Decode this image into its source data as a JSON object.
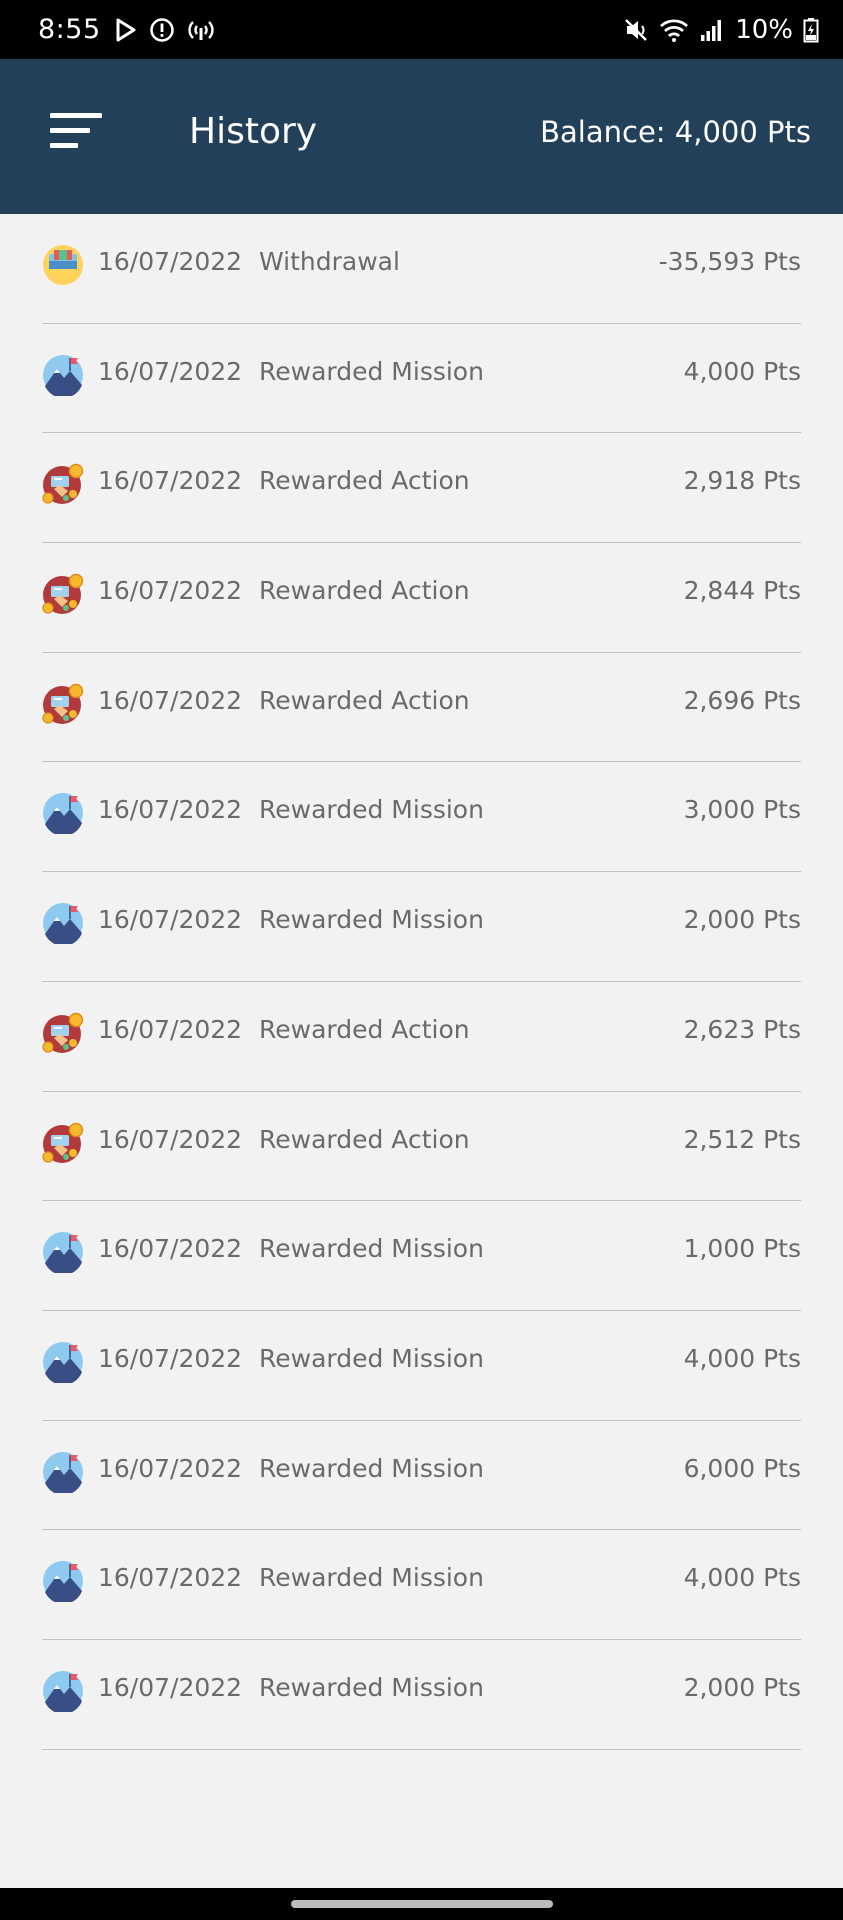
{
  "status_bar": {
    "time": "8:55",
    "battery": "10%",
    "left_icons": [
      "play-store-icon",
      "alert-icon",
      "hotspot-icon"
    ],
    "right_icons": [
      "mute-icon",
      "wifi-icon",
      "signal-icon",
      "battery-charging-icon"
    ]
  },
  "app_bar": {
    "title": "History",
    "balance": "Balance: 4,000 Pts",
    "menu_icon": "menu-icon",
    "background": "#22405a"
  },
  "history": {
    "rows": [
      {
        "icon": "withdrawal",
        "date": "16/07/2022",
        "type": "Withdrawal",
        "amount": "-35,593 Pts"
      },
      {
        "icon": "mission",
        "date": "16/07/2022",
        "type": "Rewarded Mission",
        "amount": "4,000 Pts"
      },
      {
        "icon": "action",
        "date": "16/07/2022",
        "type": "Rewarded Action",
        "amount": "2,918 Pts"
      },
      {
        "icon": "action",
        "date": "16/07/2022",
        "type": "Rewarded Action",
        "amount": "2,844 Pts"
      },
      {
        "icon": "action",
        "date": "16/07/2022",
        "type": "Rewarded Action",
        "amount": "2,696 Pts"
      },
      {
        "icon": "mission",
        "date": "16/07/2022",
        "type": "Rewarded Mission",
        "amount": "3,000 Pts"
      },
      {
        "icon": "mission",
        "date": "16/07/2022",
        "type": "Rewarded Mission",
        "amount": "2,000 Pts"
      },
      {
        "icon": "action",
        "date": "16/07/2022",
        "type": "Rewarded Action",
        "amount": "2,623 Pts"
      },
      {
        "icon": "action",
        "date": "16/07/2022",
        "type": "Rewarded Action",
        "amount": "2,512 Pts"
      },
      {
        "icon": "mission",
        "date": "16/07/2022",
        "type": "Rewarded Mission",
        "amount": "1,000 Pts"
      },
      {
        "icon": "mission",
        "date": "16/07/2022",
        "type": "Rewarded Mission",
        "amount": "4,000 Pts"
      },
      {
        "icon": "mission",
        "date": "16/07/2022",
        "type": "Rewarded Mission",
        "amount": "6,000 Pts"
      },
      {
        "icon": "mission",
        "date": "16/07/2022",
        "type": "Rewarded Mission",
        "amount": "4,000 Pts"
      },
      {
        "icon": "mission",
        "date": "16/07/2022",
        "type": "Rewarded Mission",
        "amount": "2,000 Pts"
      }
    ]
  }
}
